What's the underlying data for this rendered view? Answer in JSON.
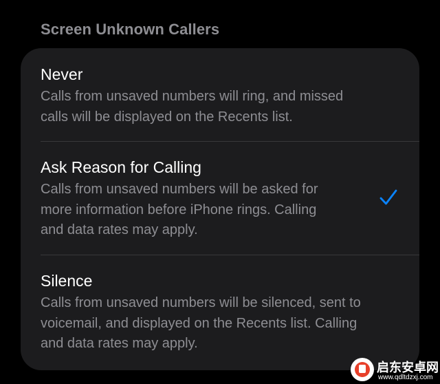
{
  "section": {
    "title": "Screen Unknown Callers"
  },
  "options": [
    {
      "title": "Never",
      "description_lines": [
        "Calls from unsaved numbers will ring, and missed",
        "calls will be displayed on the Recents list."
      ],
      "selected": false
    },
    {
      "title": "Ask Reason for Calling",
      "description_lines": [
        "Calls from unsaved numbers will be asked for",
        "more information before iPhone rings. Calling",
        "and data rates may apply."
      ],
      "selected": true
    },
    {
      "title": "Silence",
      "description_lines": [
        "Calls from unsaved numbers will be silenced, sent to",
        "voicemail, and displayed on the Recents list. Calling",
        "and data rates may apply."
      ],
      "selected": false
    }
  ],
  "checkmark_icon": "checkmark-icon",
  "watermark": {
    "name": "启东安卓网",
    "url": "www.qdltdzxj.com",
    "icon": "watermark-logo-icon"
  },
  "colors": {
    "background": "#000000",
    "group_background": "#1c1c1e",
    "title_text": "#ffffff",
    "secondary_text": "#8e8e93",
    "separator": "#38383a",
    "accent": "#0a84ff"
  }
}
